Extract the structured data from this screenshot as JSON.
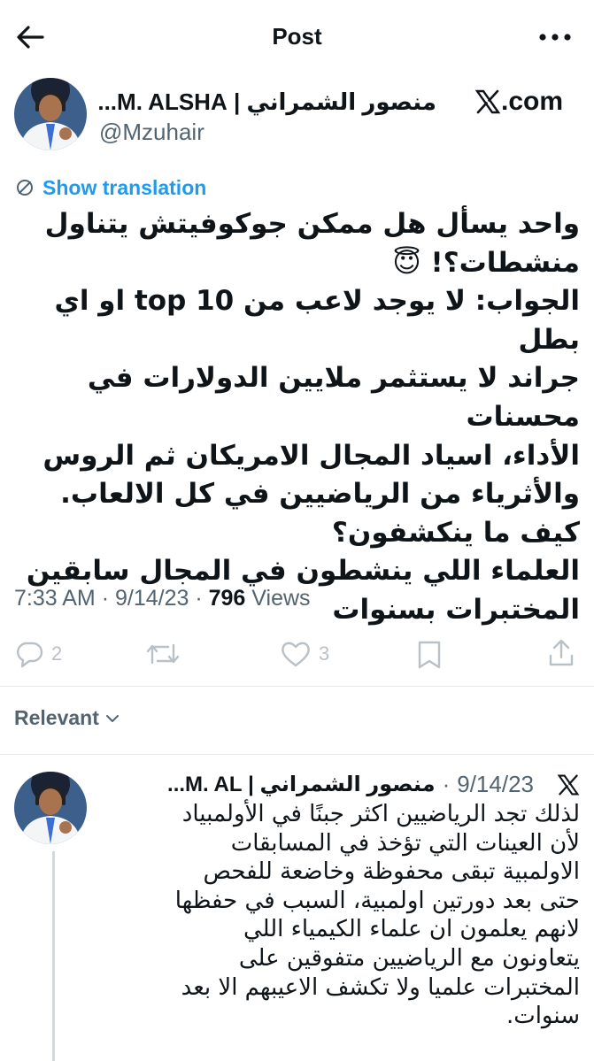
{
  "header": {
    "title": "Post"
  },
  "post": {
    "author_name": "منصور الشمراني | M. ALSHA...",
    "handle": "@Mzuhair",
    "source_label": ".com",
    "translate_label": "Show translation",
    "body": "واحد يسأل هل ممكن جوكوفيتش يتناول\nمنشطات؟! 😇\nالجواب: لا يوجد لاعب من top 10 او اي بطل\nجراند لا يستثمر ملايين الدولارات في محسنات\nالأداء، اسياد المجال الامريكان ثم الروس\nوالأثرياء من الرياضيين في كل الالعاب.\nكيف ما ينكشفون؟\nالعلماء اللي ينشطون في المجال سابقين\nالمختبرات بسنوات",
    "time": "7:33 AM",
    "date": "9/14/23",
    "views_count": "796",
    "views_label": "Views",
    "separator": "·",
    "replies_count": "2",
    "likes_count": "3"
  },
  "sort": {
    "label": "Relevant"
  },
  "reply": {
    "author_name": "منصور الشمراني | M. AL...",
    "date": "9/14/23",
    "separator": "·",
    "body": "لذلك تجد الرياضيين اكثر جبنًا في الأولمبياد\nلأن العينات التي تؤخذ في المسابقات\nالاولمبية تبقى محفوظة وخاضعة للفحص\nحتى بعد دورتين اولمبية، السبب في حفظها\nلانهم يعلمون ان علماء الكيمياء اللي\nيتعاونون مع الرياضيين متفوقين على\nالمختبرات علميا ولا تكشف الاعيبهم الا بعد\nسنوات."
  },
  "colors": {
    "link": "#1d9bf0",
    "muted": "#536471",
    "text": "#0f1419",
    "divider": "#e6e9ec"
  },
  "icons": [
    "back-arrow-icon",
    "more-icon",
    "x-logo-icon",
    "translate-icon",
    "reply-icon",
    "repost-icon",
    "like-icon",
    "bookmark-icon",
    "share-icon",
    "chevron-down-icon"
  ]
}
